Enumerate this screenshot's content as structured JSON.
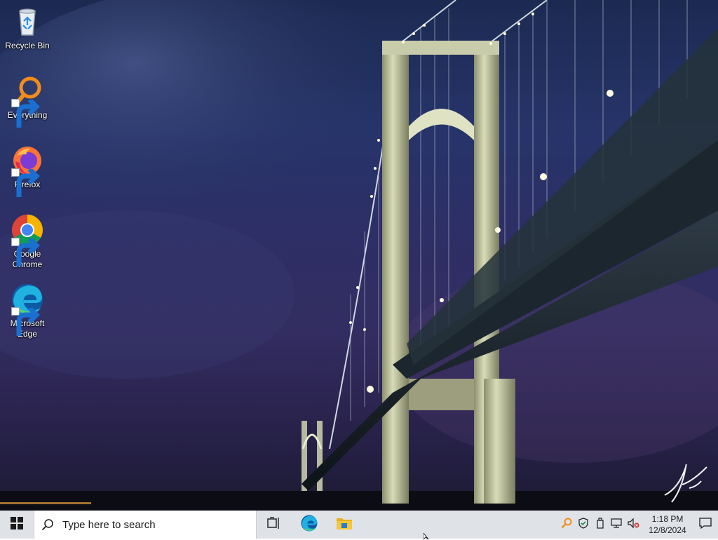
{
  "desktop": {
    "icons": [
      {
        "label": "Recycle Bin",
        "icon": "recycle-bin-icon"
      },
      {
        "label": "Everything",
        "icon": "everything-search-icon"
      },
      {
        "label": "Firefox",
        "icon": "firefox-icon"
      },
      {
        "label": "Google Chrome",
        "icon": "chrome-icon"
      },
      {
        "label": "Microsoft Edge",
        "icon": "edge-icon"
      }
    ]
  },
  "taskbar": {
    "search_placeholder": "Type here to search",
    "start_icon": "windows-start-icon",
    "task_view_icon": "task-view-icon",
    "pinned": [
      {
        "icon": "edge-icon"
      },
      {
        "icon": "file-explorer-icon"
      }
    ],
    "tray": {
      "icons": [
        "everything-tray-icon",
        "security-shield-icon",
        "usb-eject-icon",
        "network-icon",
        "volume-muted-icon"
      ],
      "time": "1:18 PM",
      "date": "12/8/2024",
      "notification_icon": "action-center-icon"
    }
  },
  "colors": {
    "taskbar_bg": "#dfe3e8",
    "search_bg": "#ffffff",
    "windows_blue": "#0078d7",
    "sky_top": "#1c2a52",
    "sky_bottom": "#1c1a33"
  }
}
